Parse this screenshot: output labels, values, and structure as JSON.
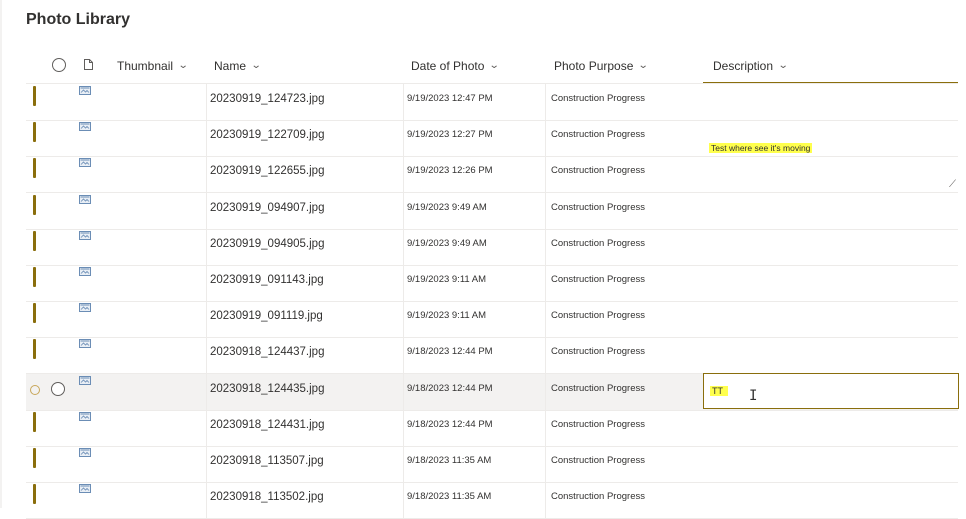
{
  "page_title": "Photo Library",
  "columns": {
    "thumbnail": "Thumbnail",
    "name": "Name",
    "date": "Date of Photo",
    "purpose": "Photo Purpose",
    "description": "Description"
  },
  "icons": {
    "select_all": "radio-circle-icon",
    "file_type": "document-icon",
    "row_file_type": "image-file-icon",
    "sort": "chevron-down-icon",
    "resize": "resize-handle-icon",
    "text_cursor": "i-beam-cursor-icon"
  },
  "colors": {
    "accent": "#8a6e0c",
    "highlight": "#ffff4d",
    "selected_row": "#f3f2f1"
  },
  "rows": [
    {
      "name": "20230919_124723.jpg",
      "date": "9/19/2023 12:47 PM",
      "purpose": "Construction Progress",
      "description": ""
    },
    {
      "name": "20230919_122709.jpg",
      "date": "9/19/2023 12:27 PM",
      "purpose": "Construction Progress",
      "description": "Test where see it's moving"
    },
    {
      "name": "20230919_122655.jpg",
      "date": "9/19/2023 12:26 PM",
      "purpose": "Construction Progress",
      "description": ""
    },
    {
      "name": "20230919_094907.jpg",
      "date": "9/19/2023 9:49 AM",
      "purpose": "Construction Progress",
      "description": ""
    },
    {
      "name": "20230919_094905.jpg",
      "date": "9/19/2023 9:49 AM",
      "purpose": "Construction Progress",
      "description": ""
    },
    {
      "name": "20230919_091143.jpg",
      "date": "9/19/2023 9:11 AM",
      "purpose": "Construction Progress",
      "description": ""
    },
    {
      "name": "20230919_091119.jpg",
      "date": "9/19/2023 9:11 AM",
      "purpose": "Construction Progress",
      "description": ""
    },
    {
      "name": "20230918_124437.jpg",
      "date": "9/18/2023 12:44 PM",
      "purpose": "Construction Progress",
      "description": ""
    },
    {
      "name": "20230918_124435.jpg",
      "date": "9/18/2023 12:44 PM",
      "purpose": "Construction Progress",
      "description": "TT"
    },
    {
      "name": "20230918_124431.jpg",
      "date": "9/18/2023 12:44 PM",
      "purpose": "Construction Progress",
      "description": ""
    },
    {
      "name": "20230918_113507.jpg",
      "date": "9/18/2023 11:35 AM",
      "purpose": "Construction Progress",
      "description": ""
    },
    {
      "name": "20230918_113502.jpg",
      "date": "9/18/2023 11:35 AM",
      "purpose": "Construction Progress",
      "description": ""
    }
  ]
}
